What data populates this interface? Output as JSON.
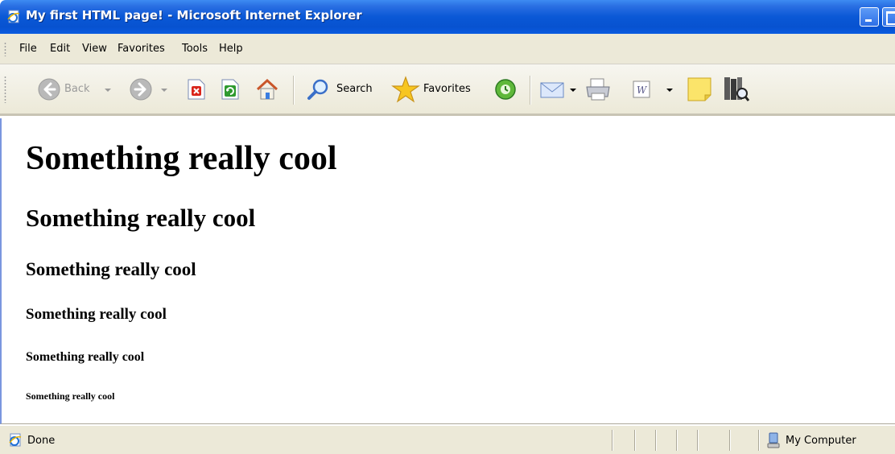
{
  "window": {
    "title": "My first HTML page! - Microsoft Internet Explorer",
    "app_icon": "ie-page-icon",
    "title_color": "#0a58d6"
  },
  "menu": {
    "items": [
      "File",
      "Edit",
      "View",
      "Favorites",
      "Tools",
      "Help"
    ]
  },
  "toolbar": {
    "back_label": "Back",
    "search_label": "Search",
    "favorites_label": "Favorites"
  },
  "page": {
    "h1": "Something really cool",
    "h2": "Something really cool",
    "h3": "Something really cool",
    "h4": "Something really cool",
    "h5": "Something really cool",
    "h6": "Something really cool"
  },
  "status": {
    "text": "Done",
    "zone": "My Computer"
  }
}
